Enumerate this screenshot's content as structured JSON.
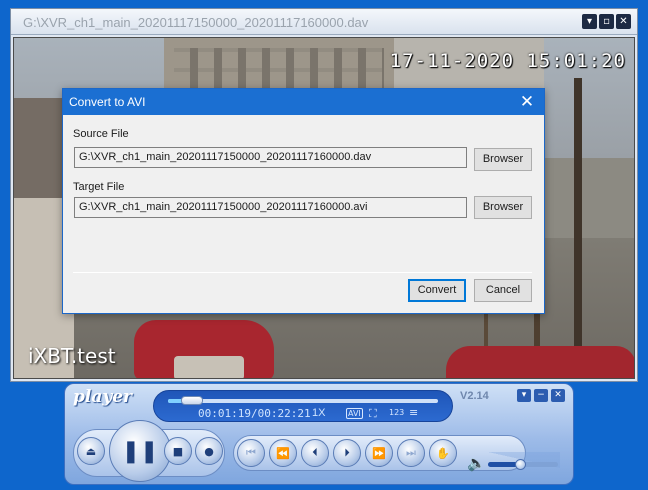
{
  "video_window": {
    "title": "G:\\XVR_ch1_main_20201117150000_20201117160000.dav",
    "buttons": {
      "minimize": "▾",
      "restore": "▫",
      "close": "✕"
    },
    "overlay_timestamp": "17-11-2020 15:01:20",
    "watermark": "iXBT.test"
  },
  "dialog": {
    "title": "Convert to AVI",
    "close_glyph": "✕",
    "source_label": "Source File",
    "source_value": "G:\\XVR_ch1_main_20201117150000_20201117160000.dav",
    "target_label": "Target File",
    "target_value": "G:\\XVR_ch1_main_20201117150000_20201117160000.avi",
    "browse_label": "Browser",
    "convert_label": "Convert",
    "cancel_label": "Cancel"
  },
  "player": {
    "logo": "player",
    "version": "V2.14",
    "window_buttons": {
      "menu": "▾",
      "minimize": "−",
      "close": "✕"
    },
    "time": "00:01:19/00:22:21",
    "speed": "1X",
    "seek_progress": 0.09,
    "volume": 0.45,
    "icons": {
      "eject": "⏏",
      "pause": "❚❚",
      "stop": "■",
      "record": "●",
      "prev_segment": "⏮",
      "rewind": "⏪",
      "step_back": "⏴",
      "step_forward": "⏵",
      "fast_forward": "⏩",
      "next_segment": "⏭",
      "snapshot": "✋",
      "volume": "🔈",
      "avi": "AVI",
      "fullscreen": "⛶",
      "numbers": "123",
      "list": "≡"
    }
  }
}
